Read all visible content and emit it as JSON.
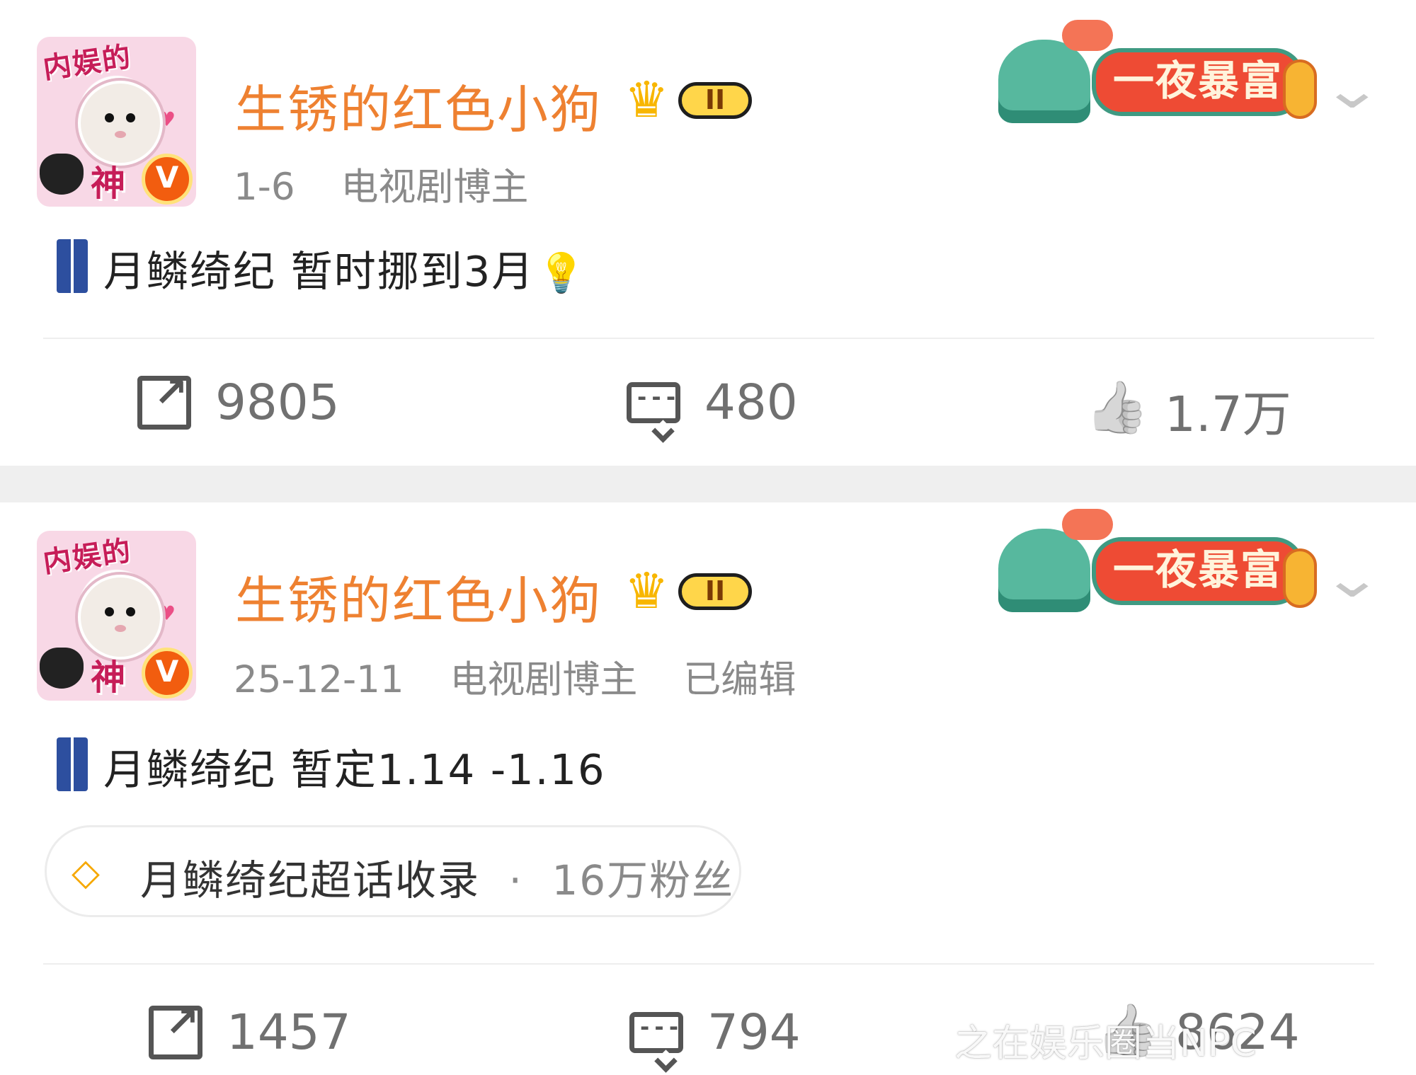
{
  "posts": [
    {
      "avatar": {
        "top_text": "内娱的",
        "bottom_text": "神",
        "badge": "V"
      },
      "username": "生锈的红色小狗",
      "level": "II",
      "banner_text": "一夜暴富",
      "date": "1-6",
      "category": "电视剧博主",
      "content": "月鳞绮纪 暂时挪到3月",
      "stats": {
        "repost": "9805",
        "comment": "480",
        "like": "1.7万"
      }
    },
    {
      "avatar": {
        "top_text": "内娱的",
        "bottom_text": "神",
        "badge": "V"
      },
      "username": "生锈的红色小狗",
      "level": "II",
      "banner_text": "一夜暴富",
      "date": "25-12-11",
      "category": "电视剧博主",
      "edited": "已编辑",
      "content": "月鳞绮纪 暂定1.14 -1.16",
      "topic": {
        "title": "月鳞绮纪超话收录",
        "fans": "16万粉丝"
      },
      "stats": {
        "repost": "1457",
        "comment": "794",
        "like": "8624"
      }
    }
  ],
  "watermark": {
    "text": "之在娱乐圈当NPC"
  },
  "colors": {
    "username": "#ee8131",
    "meta": "#8a8a8a",
    "banner": "#ee4b34",
    "tree": "#57b89e"
  },
  "icons": {
    "repost": "repost-icon",
    "comment": "comment-icon",
    "like": "like-icon",
    "topic": "diamond-icon",
    "more": "chevron-down-icon"
  }
}
